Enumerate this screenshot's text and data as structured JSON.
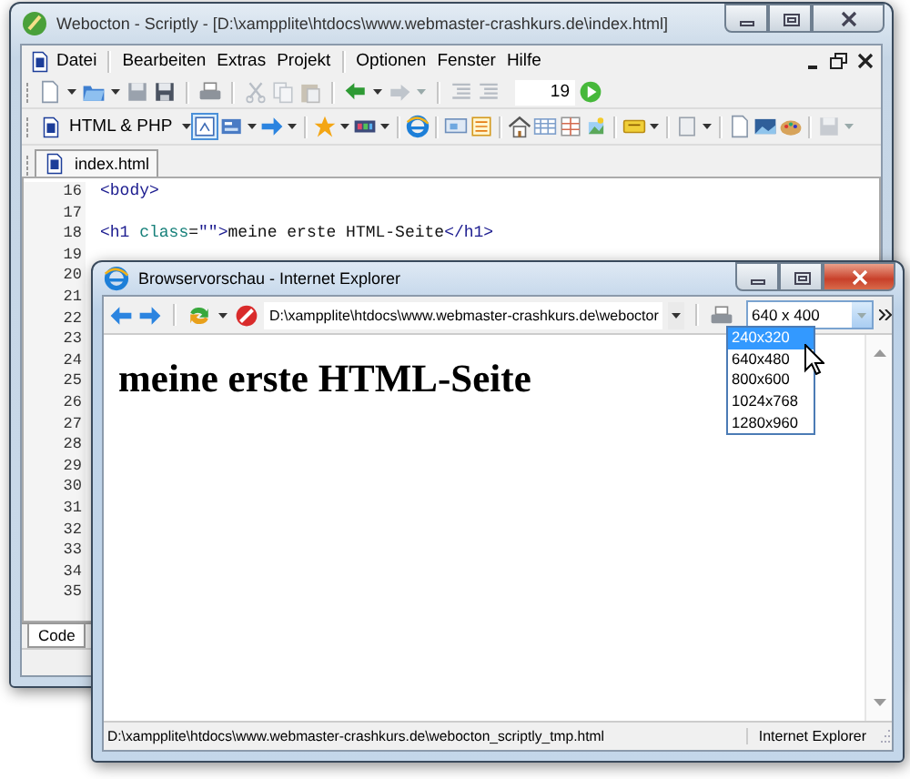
{
  "editor_window": {
    "title": "Webocton - Scriptly - [D:\\xampplite\\htdocs\\www.webmaster-crashkurs.de\\index.html]",
    "menu": [
      {
        "label": "Datei"
      },
      {
        "label": "Bearbeiten"
      },
      {
        "label": "Extras"
      },
      {
        "label": "Projekt"
      },
      {
        "label": "Optionen"
      },
      {
        "label": "Fenster"
      },
      {
        "label": "Hilfe"
      }
    ],
    "line_field": "19",
    "language_select": "HTML & PHP",
    "tabs": [
      {
        "label": "index.html",
        "selected": true
      }
    ],
    "code_lines": [
      {
        "number": "16",
        "tokens": [
          {
            "kind": "tag",
            "text": "<body>"
          }
        ]
      },
      {
        "number": "17"
      },
      {
        "number": "18",
        "tokens": [
          {
            "kind": "tag",
            "text": "<h1"
          },
          {
            "kind": "attr",
            "text": " class"
          },
          {
            "kind": "plain",
            "text": "="
          },
          {
            "kind": "string",
            "text": "\"\""
          },
          {
            "kind": "tag",
            "text": ">"
          },
          {
            "kind": "plain",
            "text": "meine erste HTML-Seite"
          },
          {
            "kind": "tag",
            "text": "</h1>"
          }
        ]
      },
      {
        "number": "19"
      },
      {
        "number": "20"
      },
      {
        "number": "21"
      },
      {
        "number": "22"
      },
      {
        "number": "23"
      },
      {
        "number": "24"
      },
      {
        "number": "25"
      },
      {
        "number": "26"
      },
      {
        "number": "27"
      },
      {
        "number": "28"
      },
      {
        "number": "29"
      },
      {
        "number": "30"
      },
      {
        "number": "31"
      },
      {
        "number": "32"
      },
      {
        "number": "33"
      },
      {
        "number": "34"
      },
      {
        "number": "35"
      }
    ],
    "bottom_tabs": [
      {
        "label": "Code",
        "selected": true
      }
    ]
  },
  "browser_window": {
    "title": "Browservorschau - Internet Explorer",
    "address": "D:\\xampplite\\htdocs\\www.webmaster-crashkurs.de\\weboctor",
    "size_select": "640 x 400",
    "size_options": [
      {
        "label": "240x320",
        "selected": true
      },
      {
        "label": "640x480",
        "selected": false
      },
      {
        "label": "800x600",
        "selected": false
      },
      {
        "label": "1024x768",
        "selected": false
      },
      {
        "label": "1280x960",
        "selected": false
      }
    ],
    "heading": "meine erste HTML-Seite",
    "status_text": "D:\\xampplite\\htdocs\\www.webmaster-crashkurs.de\\webocton_scriptly_tmp.html",
    "status_zone": "Internet Explorer"
  }
}
